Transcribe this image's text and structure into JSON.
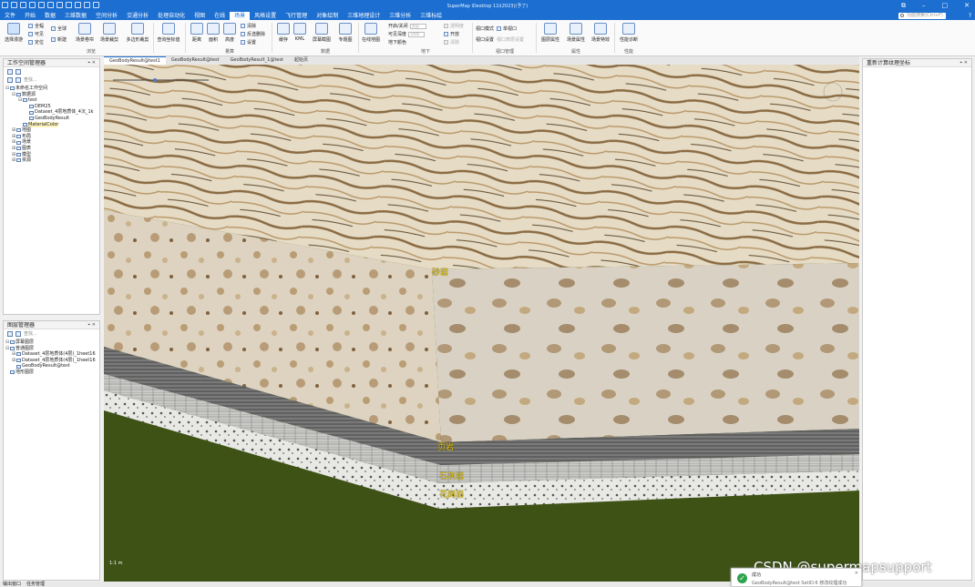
{
  "app": {
    "title": "SuperMap iDesktop 11i(2023)(予了)"
  },
  "window_controls": {
    "restore": "⧉",
    "minimize": "–",
    "maximize": "□",
    "close": "✕"
  },
  "menu": {
    "tabs": [
      "文件",
      "开始",
      "数据",
      "三维数据",
      "空间分析",
      "交通分析",
      "处理自动化",
      "视图",
      "在线",
      "场景",
      "风格设置",
      "飞行管理",
      "对象绘制",
      "三维地理设计",
      "三维分析",
      "三维标绘"
    ],
    "active": "场景",
    "search_placeholder": "功能搜索(Ctrl+F)",
    "help": "?"
  },
  "ribbon": {
    "browse": {
      "select": "选择漫游",
      "full": "全幅",
      "visible": "可见",
      "locate": "定位",
      "full2": "全球",
      "new": "新建",
      "scene_fly": "场景卷帘",
      "scene_bounds": "场景裁剪",
      "polygon_clip": "多边形裁剪",
      "label": "浏览"
    },
    "query_coord": "查询坐标值",
    "measure": {
      "distance": "距离",
      "area": "面积",
      "height": "高度",
      "clear": "清除",
      "show_clear": "反选删除",
      "settings": "设置",
      "label": "量算"
    },
    "data": {
      "cache": "缓存",
      "kml": "KML",
      "scene_screenshot": "屏幕截图",
      "print": "专题图",
      "label": "数据"
    },
    "underground": {
      "online_map": "在线地图",
      "enable": "开启/关闭",
      "visible_depth": "可见深度",
      "underground_color": "地下颜色",
      "toggle_value": "关闭",
      "depth_value": "1000",
      "transparent": "透明度",
      "open": "开放",
      "remove": "清除",
      "label": "地下"
    },
    "viewport": {
      "mode": "视口模式",
      "single": "单视口",
      "settings": "视口设置",
      "sync": "视口表层设置",
      "label": "视口管理"
    },
    "properties": {
      "layer_props": "图层属性",
      "scene_props": "场景属性",
      "scene_effects": "场景特效",
      "label": "属性"
    },
    "performance": {
      "diagnose": "性能诊断",
      "label": "性能"
    }
  },
  "workspace_panel": {
    "title": "工作空间管理器",
    "toolbar_hint": "查找...",
    "tree": [
      {
        "level": 0,
        "toggle": "⊟",
        "label": "未命名工作空间"
      },
      {
        "level": 1,
        "toggle": "⊟",
        "label": "数据源"
      },
      {
        "level": 2,
        "toggle": "⊟",
        "label": "test"
      },
      {
        "level": 3,
        "toggle": "",
        "label": "DEM25"
      },
      {
        "level": 3,
        "toggle": "",
        "label": "Dataset_4层地质体_4沉_1k"
      },
      {
        "level": 3,
        "toggle": "",
        "label": "GeoBodyResult"
      },
      {
        "level": 2,
        "toggle": "",
        "label": "MaterialColor",
        "highlight": true
      },
      {
        "level": 1,
        "toggle": "⊞",
        "label": "地图"
      },
      {
        "level": 1,
        "toggle": "⊞",
        "label": "布局"
      },
      {
        "level": 1,
        "toggle": "⊞",
        "label": "场景"
      },
      {
        "level": 1,
        "toggle": "⊞",
        "label": "图表"
      },
      {
        "level": 1,
        "toggle": "⊞",
        "label": "模型"
      },
      {
        "level": 1,
        "toggle": "⊞",
        "label": "资源"
      }
    ]
  },
  "layer_panel": {
    "title": "图层管理器",
    "toolbar_hint": "查找...",
    "tree": [
      {
        "level": 0,
        "toggle": "⊟",
        "label": "屏幕图层"
      },
      {
        "level": 0,
        "toggle": "⊟",
        "label": "普通图层"
      },
      {
        "level": 1,
        "toggle": "⊞",
        "label": "Dataset_4层地质体(4层)_1heet16"
      },
      {
        "level": 1,
        "toggle": "⊞",
        "label": "Dataset_4层地质体(4层)_1heet16"
      },
      {
        "level": 1,
        "toggle": "",
        "label": "GeoBodyResult@test"
      },
      {
        "level": 0,
        "toggle": "",
        "label": "地形图层"
      }
    ]
  },
  "right_panel": {
    "title": "重新计算纹理坐标"
  },
  "doc_tabs": [
    "GeoBodyResult@test1",
    "GeoBodyResult@test",
    "GeoBodyResult_1@test",
    "起始页"
  ],
  "doc_tab_active": 0,
  "strata": [
    "砂岩",
    "页岩",
    "石灰岩",
    "花岗岩"
  ],
  "scale_text": "1:1 m",
  "status_bar": [
    "输出窗口",
    "任务管理"
  ],
  "toast": {
    "title": "成功",
    "message": "GeoBodyResult@test SetID:6  修改纹理成功",
    "close": "✕"
  },
  "watermark": "CSDN @supermapsupport",
  "colors": {
    "brand": "#1c6fd0",
    "ground": "#3d5214",
    "label": "#f2d100"
  }
}
